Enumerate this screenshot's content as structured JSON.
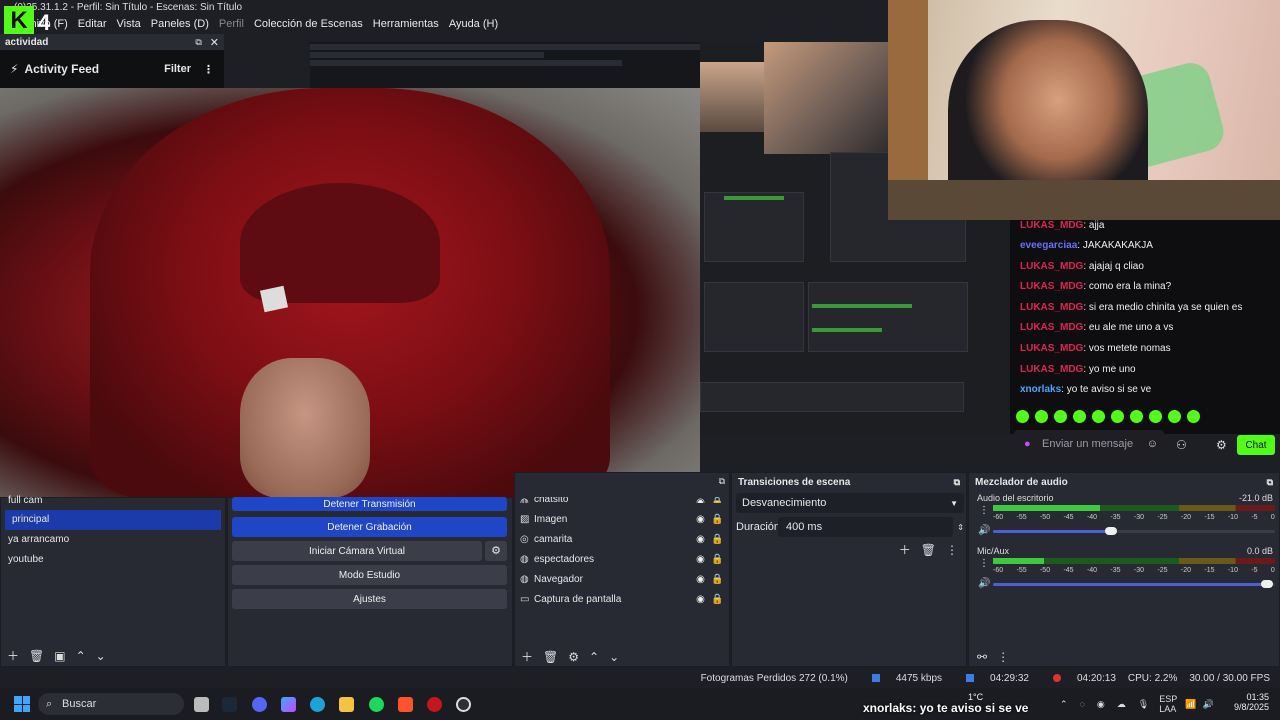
{
  "window": {
    "title": "OBS 31.1.2 - Perfil: Sin Título - Escenas: Sin Título",
    "title_visible": "(0)35.31.1.2 - Perfil: Sin Título - Escenas: Sin Título",
    "logo_text": "4"
  },
  "menu": [
    "Archivo (F)",
    "Editar",
    "Vista",
    "Paneles (D)",
    "Perfil",
    "Colección de Escenas",
    "Herramientas",
    "Ayuda (H)"
  ],
  "activity_dock": {
    "title": "actividad",
    "feed_title": "Activity Feed",
    "filter_label": "Filter"
  },
  "chat": {
    "messages": [
      {
        "user": "LUKAS_MDG",
        "text": ": ajja",
        "color": "#e0224e"
      },
      {
        "user": "eveegarciaa",
        "text": ": JAKAKAKAKJA",
        "color": "#6f6ff6"
      },
      {
        "user": "LUKAS_MDG",
        "text": ": ajajaj q cliao",
        "color": "#e0224e"
      },
      {
        "user": "LUKAS_MDG",
        "text": ": como era la mina?",
        "color": "#e0224e"
      },
      {
        "user": "LUKAS_MDG",
        "text": ": si era medio chinita ya se quien es",
        "color": "#e0224e"
      },
      {
        "user": "LUKAS_MDG",
        "text": ": eu ale me uno a vs",
        "color": "#e0224e"
      },
      {
        "user": "LUKAS_MDG",
        "text": ": vos metete nomas",
        "color": "#e0224e"
      },
      {
        "user": "LUKAS_MDG",
        "text": ": yo me uno",
        "color": "#e0224e"
      },
      {
        "user": "xnorlaks",
        "text": ": yo te aviso si se ve",
        "color": "#4aa3ff"
      }
    ],
    "input_placeholder": "Enviar un mensaje",
    "send_label": "Chat"
  },
  "scenes": {
    "items": [
      "full cam",
      "principal",
      "ya arrancamo",
      "youtube"
    ],
    "active": "principal"
  },
  "controls": {
    "stop_stream": "Detener Transmisión",
    "stop_record": "Detener Grabación",
    "virtual_cam": "Iniciar Cámara Virtual",
    "studio_mode": "Modo Estudio",
    "settings": "Ajustes"
  },
  "sources": {
    "items": [
      {
        "name": "chatsito",
        "icon": "globe-icon"
      },
      {
        "name": "Imagen",
        "icon": "image-icon"
      },
      {
        "name": "camarita",
        "icon": "camera-icon"
      },
      {
        "name": "espectadores",
        "icon": "globe-icon"
      },
      {
        "name": "Navegador",
        "icon": "globe-icon"
      },
      {
        "name": "Captura de pantalla",
        "icon": "monitor-icon"
      }
    ]
  },
  "transitions": {
    "title": "Transiciones de escena",
    "selected": "Desvanecimiento",
    "duration_label": "Duración",
    "duration_value": "400 ms"
  },
  "mixer": {
    "title": "Mezclador de audio",
    "channels": [
      {
        "name": "Audio del escritorio",
        "db": "-21.0 dB",
        "level": 0.38,
        "volume": 0.42
      },
      {
        "name": "Mic/Aux",
        "db": "0.0 dB",
        "level": 0.18,
        "volume": 0.97
      }
    ],
    "ticks": [
      "-60",
      "-55",
      "-50",
      "-45",
      "-40",
      "-35",
      "-30",
      "-25",
      "-20",
      "-15",
      "-10",
      "-5",
      "0"
    ]
  },
  "status": {
    "dropped_frames": "Fotogramas Perdidos 272 (0.1%)",
    "bitrate": "4475 kbps",
    "stream_time": "04:29:32",
    "record_time": "04:20:13",
    "cpu": "CPU: 2.2%",
    "fps": "30.00 / 30.00 FPS"
  },
  "taskbar": {
    "search_label": "Buscar",
    "overlay_user": "xnorlaks",
    "overlay_text": ": yo te aviso si se ve",
    "temperature": "1°C",
    "lang1": "ESP",
    "lang2": "LAA",
    "time": "01:35",
    "date": "9/8/2025"
  },
  "colors": {
    "kick_green": "#53fc18",
    "obs_blue": "#1f46c6",
    "dock_bg": "#272a33"
  }
}
